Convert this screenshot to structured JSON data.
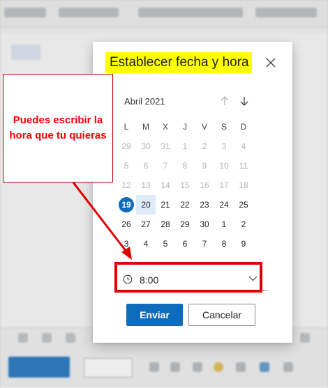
{
  "dialog": {
    "title": "Establecer fecha y hora",
    "close_icon": "close-icon",
    "month_label": "Abril 2021",
    "nav": {
      "prev_icon": "arrow-up-icon",
      "next_icon": "arrow-down-icon"
    },
    "weekdays": [
      "L",
      "M",
      "X",
      "J",
      "V",
      "S",
      "D"
    ],
    "weeks": [
      [
        "29",
        "30",
        "31",
        "1",
        "2",
        "3",
        "4"
      ],
      [
        "5",
        "6",
        "7",
        "8",
        "9",
        "10",
        "11"
      ],
      [
        "12",
        "13",
        "14",
        "15",
        "16",
        "17",
        "18"
      ],
      [
        "19",
        "20",
        "21",
        "22",
        "23",
        "24",
        "25"
      ],
      [
        "26",
        "27",
        "28",
        "29",
        "30",
        "1",
        "2"
      ],
      [
        "3",
        "4",
        "5",
        "6",
        "7",
        "8",
        "9"
      ]
    ],
    "today": "19",
    "selected": "20",
    "time": {
      "value": "8:00",
      "clock_icon": "clock-icon",
      "chevron_icon": "chevron-down-icon"
    },
    "send_label": "Enviar",
    "cancel_label": "Cancelar"
  },
  "annotation": {
    "callout_text": "Puedes escribir la hora que tu quieras"
  },
  "colors": {
    "accent": "#0f6cbd",
    "highlight": "#ffff00",
    "annotation_red": "#e00000",
    "selected_day_bg": "#deecf9"
  }
}
